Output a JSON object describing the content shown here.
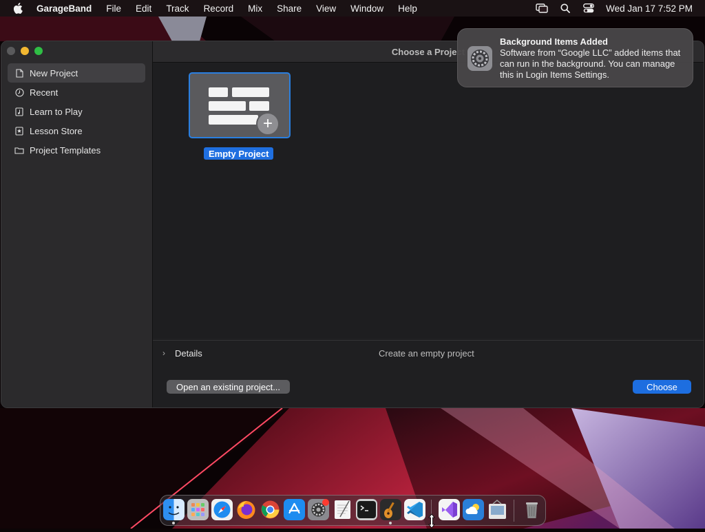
{
  "menubar": {
    "app_name": "GarageBand",
    "items": [
      "File",
      "Edit",
      "Track",
      "Record",
      "Mix",
      "Share",
      "View",
      "Window",
      "Help"
    ],
    "clock": "Wed Jan 17  7:52 PM",
    "status_icons": [
      "screen-mirroring-icon",
      "search-icon",
      "control-center-icon"
    ]
  },
  "window": {
    "title": "Choose a Project",
    "sidebar": {
      "items": [
        {
          "label": "New Project",
          "icon": "document-icon",
          "selected": true
        },
        {
          "label": "Recent",
          "icon": "clock-icon",
          "selected": false
        },
        {
          "label": "Learn to Play",
          "icon": "music-book-icon",
          "selected": false
        },
        {
          "label": "Lesson Store",
          "icon": "star-icon",
          "selected": false
        },
        {
          "label": "Project Templates",
          "icon": "folder-icon",
          "selected": false
        }
      ]
    },
    "projects": [
      {
        "label": "Empty Project",
        "selected": true
      }
    ],
    "details": {
      "label": "Details",
      "description": "Create an empty project"
    },
    "buttons": {
      "open_existing": "Open an existing project...",
      "choose": "Choose"
    }
  },
  "notification": {
    "title": "Background Items Added",
    "body": "Software from “Google LLC” added items that can run in the background. You can manage this in Login Items Settings.",
    "icon": "system-settings-icon"
  },
  "dock": {
    "apps": [
      {
        "name": "finder-icon",
        "running": true
      },
      {
        "name": "launchpad-icon",
        "running": false
      },
      {
        "name": "safari-icon",
        "running": false
      },
      {
        "name": "firefox-icon",
        "running": false
      },
      {
        "name": "chrome-icon",
        "running": false
      },
      {
        "name": "app-store-icon",
        "running": false
      },
      {
        "name": "system-settings-icon",
        "running": false,
        "badge": "1"
      },
      {
        "name": "textedit-icon",
        "running": false
      },
      {
        "name": "terminal-icon",
        "running": false
      },
      {
        "name": "garageband-icon",
        "running": true
      },
      {
        "name": "vscode-icon",
        "running": false
      },
      {
        "name": "visual-studio-icon",
        "running": false
      },
      {
        "name": "weather-icon",
        "running": false
      },
      {
        "name": "preview-icon",
        "running": false
      },
      {
        "name": "trash-icon",
        "running": false
      }
    ]
  },
  "colors": {
    "accent": "#1d6ee0",
    "selection_border": "#2a7fe0",
    "traffic_close": "#5a5a5c",
    "traffic_minimize": "#f2b731",
    "traffic_maximize": "#2fbe45"
  }
}
